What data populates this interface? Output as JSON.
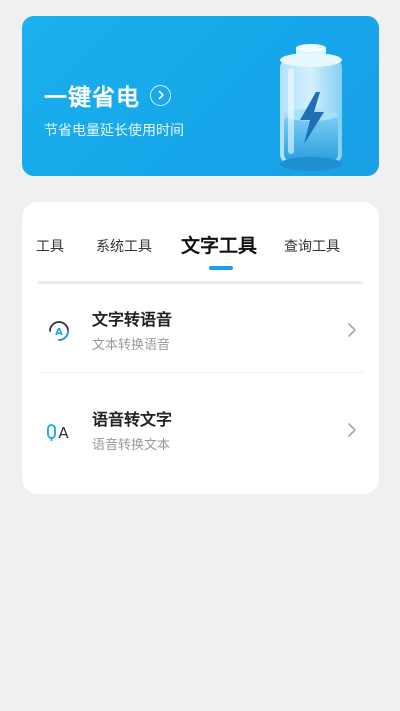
{
  "banner": {
    "title": "一键省电",
    "subtitle": "节省电量延长使用时间",
    "accent_color": "#1aaef0",
    "arrow_icon": "chevron-right-circle-icon",
    "illustration": "battery-lightning-icon"
  },
  "tabs": [
    {
      "label": "工具"
    },
    {
      "label": "系统工具"
    },
    {
      "label": "文字工具",
      "active": true
    },
    {
      "label": "查询工具"
    }
  ],
  "tools": [
    {
      "title": "文字转语音",
      "subtitle": "文本转换语音",
      "icon": "text-to-speech-icon"
    },
    {
      "title": "语音转文字",
      "subtitle": "语音转换文本",
      "icon": "speech-to-text-icon"
    }
  ]
}
